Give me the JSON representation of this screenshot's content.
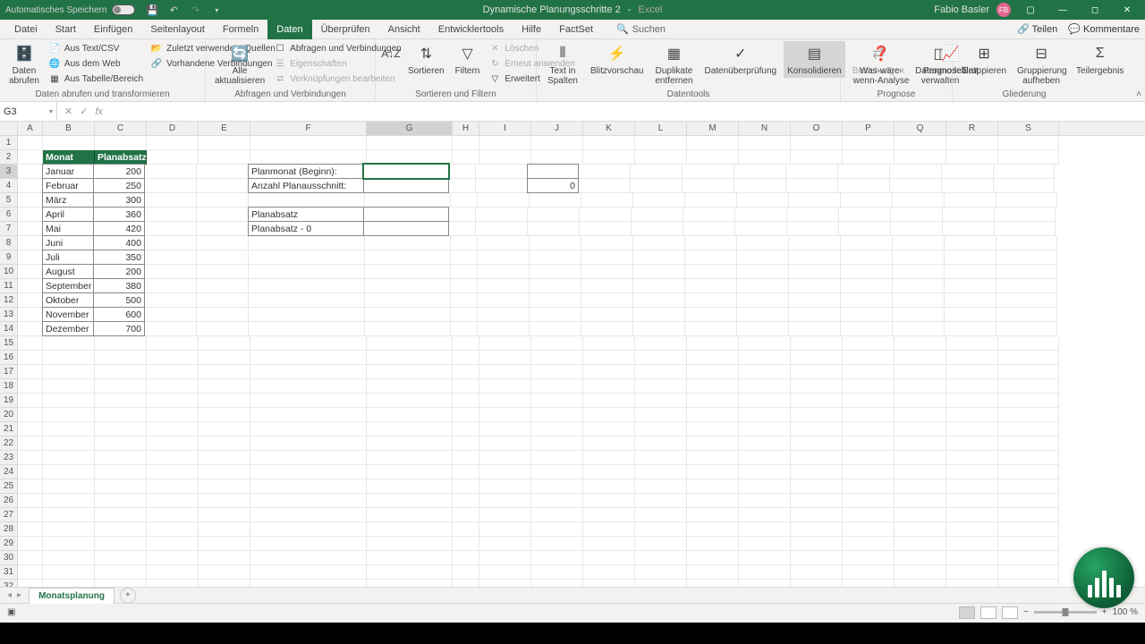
{
  "titlebar": {
    "autosave_label": "Automatisches Speichern",
    "doc_name": "Dynamische Planungsschritte 2",
    "app_name": "Excel",
    "user_name": "Fabio Basler",
    "user_initials": "FB"
  },
  "menu": {
    "tabs": [
      "Datei",
      "Start",
      "Einfügen",
      "Seitenlayout",
      "Formeln",
      "Daten",
      "Überprüfen",
      "Ansicht",
      "Entwicklertools",
      "Hilfe",
      "FactSet"
    ],
    "active_index": 5,
    "search": "Suchen",
    "share": "Teilen",
    "comments": "Kommentare"
  },
  "ribbon": {
    "g1": {
      "btn": "Daten abrufen",
      "small": [
        "Aus Text/CSV",
        "Aus dem Web",
        "Aus Tabelle/Bereich",
        "Zuletzt verwendete Quellen",
        "Vorhandene Verbindungen"
      ],
      "label": "Daten abrufen und transformieren"
    },
    "g2": {
      "btn": "Alle aktualisieren",
      "small": [
        "Abfragen und Verbindungen",
        "Eigenschaften",
        "Verknüpfungen bearbeiten"
      ],
      "label": "Abfragen und Verbindungen"
    },
    "g3": {
      "btns": [
        "Sortieren",
        "Filtern"
      ],
      "small": [
        "Löschen",
        "Erneut anwenden",
        "Erweitert"
      ],
      "label": "Sortieren und Filtern"
    },
    "g4": {
      "btns": [
        "Text in Spalten",
        "Blitzvorschau",
        "Duplikate entfernen",
        "Datenüberprüfung",
        "Konsolidieren",
        "Beziehungen",
        "Datenmodell verwalten"
      ],
      "label": "Datentools"
    },
    "g5": {
      "btns": [
        "Was-wäre-wenn-Analyse",
        "Prognoseblatt"
      ],
      "label": "Prognose"
    },
    "g6": {
      "btns": [
        "Gruppieren",
        "Gruppierung aufheben",
        "Teilergebnis"
      ],
      "label": "Gliederung"
    }
  },
  "namebox": "G3",
  "columns": [
    "A",
    "B",
    "C",
    "D",
    "E",
    "F",
    "G",
    "H",
    "I",
    "J",
    "K",
    "L",
    "M",
    "N",
    "O",
    "P",
    "Q",
    "R",
    "S"
  ],
  "selected_col_index": 6,
  "selected_row": 3,
  "table": {
    "headers": [
      "Monat",
      "Planabsatz"
    ],
    "rows": [
      [
        "Januar",
        200
      ],
      [
        "Februar",
        250
      ],
      [
        "März",
        300
      ],
      [
        "April",
        360
      ],
      [
        "Mai",
        420
      ],
      [
        "Juni",
        400
      ],
      [
        "Juli",
        350
      ],
      [
        "August",
        200
      ],
      [
        "September",
        380
      ],
      [
        "Oktober",
        500
      ],
      [
        "November",
        600
      ],
      [
        "Dezember",
        700
      ]
    ]
  },
  "form": {
    "f1": "Planmonat (Beginn):",
    "f2": "Anzahl Planausschnitt:",
    "f3": "Planabsatz",
    "f4": "Planabsatz   -  0",
    "j4": "0"
  },
  "sheet": {
    "name": "Monatsplanung"
  },
  "status": {
    "zoom": "100 %"
  }
}
